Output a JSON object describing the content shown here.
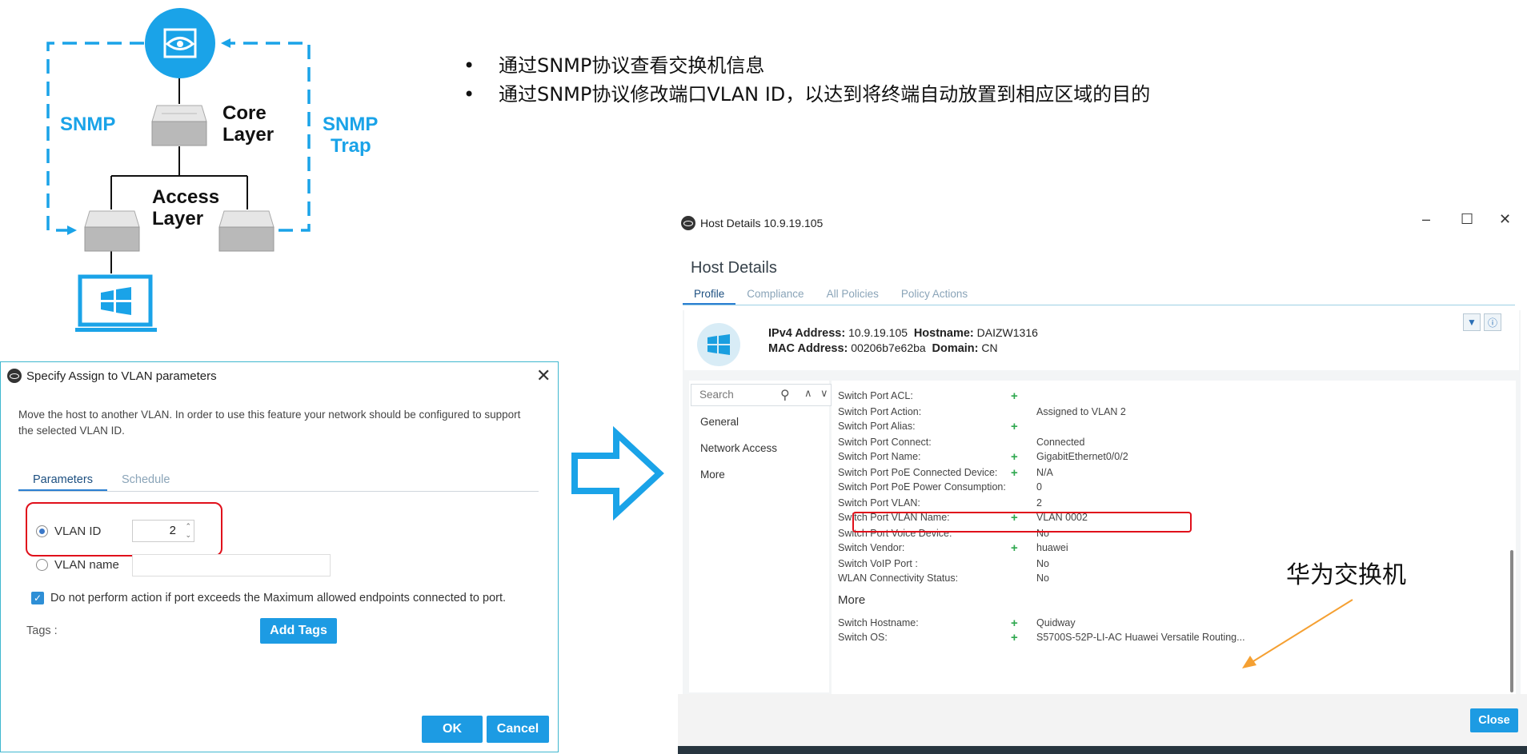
{
  "diagram": {
    "snmp_left": "SNMP",
    "snmp_right_1": "SNMP",
    "snmp_right_2": "Trap",
    "core_1": "Core",
    "core_2": "Layer",
    "access_1": "Access",
    "access_2": "Layer"
  },
  "bullets": [
    "通过SNMP协议查看交换机信息",
    "通过SNMP协议修改端口VLAN ID，以达到将终端自动放置到相应区域的目的"
  ],
  "vlan_dialog": {
    "title": "Specify Assign to VLAN parameters",
    "description": "Move the host to another VLAN. In order to use this feature your network should be configured to support the selected VLAN ID.",
    "tabs": [
      "Parameters",
      "Schedule"
    ],
    "vlan_id_label": "VLAN ID",
    "vlan_id_value": "2",
    "vlan_name_label": "VLAN name",
    "checkbox_label": "Do not perform action if port exceeds the Maximum allowed endpoints connected to port.",
    "tags_label": "Tags :",
    "add_tags": "Add Tags",
    "ok": "OK",
    "cancel": "Cancel"
  },
  "host_window": {
    "title": "Host Details 10.9.19.105",
    "heading": "Host Details",
    "tabs": [
      "Profile",
      "Compliance",
      "All Policies",
      "Policy Actions"
    ],
    "ipv4_label": "IPv4 Address:",
    "ipv4_value": "10.9.19.105",
    "hostname_label": "Hostname:",
    "hostname_value": "DAIZW1316",
    "mac_label": "MAC Address:",
    "mac_value": "00206b7e62ba",
    "domain_label": "Domain:",
    "domain_value": "CN",
    "search_placeholder": "Search",
    "side_items": [
      "General",
      "Network Access",
      "More"
    ],
    "properties": [
      {
        "key": "Switch Port ACL:",
        "plus": "+",
        "value": ""
      },
      {
        "key": "Switch Port Action:",
        "plus": "",
        "value": "Assigned to VLAN 2"
      },
      {
        "key": "Switch Port Alias:",
        "plus": "+",
        "value": ""
      },
      {
        "key": "Switch Port Connect:",
        "plus": "",
        "value": "Connected"
      },
      {
        "key": "Switch Port Name:",
        "plus": "+",
        "value": "GigabitEthernet0/0/2"
      },
      {
        "key": "Switch Port PoE Connected Device:",
        "plus": "+",
        "value": "N/A"
      },
      {
        "key": "Switch Port PoE Power Consumption:",
        "plus": "",
        "value": "0"
      },
      {
        "key": "Switch Port VLAN:",
        "plus": "",
        "value": "2"
      },
      {
        "key": "Switch Port VLAN Name:",
        "plus": "+",
        "value": "VLAN 0002"
      },
      {
        "key": "Switch Port Voice Device:",
        "plus": "",
        "value": "No"
      },
      {
        "key": "Switch Vendor:",
        "plus": "+",
        "value": "huawei"
      },
      {
        "key": "Switch VoIP Port :",
        "plus": "",
        "value": "No"
      },
      {
        "key": "WLAN Connectivity Status:",
        "plus": "",
        "value": "No"
      }
    ],
    "more_heading": "More",
    "more_properties": [
      {
        "key": "Switch Hostname:",
        "plus": "+",
        "value": "Quidway"
      },
      {
        "key": "Switch OS:",
        "plus": "+",
        "value": "S5700S-52P-LI-AC Huawei Versatile Routing..."
      }
    ],
    "close": "Close"
  },
  "annotation": "华为交换机",
  "colors": {
    "accent": "#1aa3e8",
    "button": "#1d9be3",
    "highlight": "#e0101b",
    "arrow": "#f5a032"
  }
}
